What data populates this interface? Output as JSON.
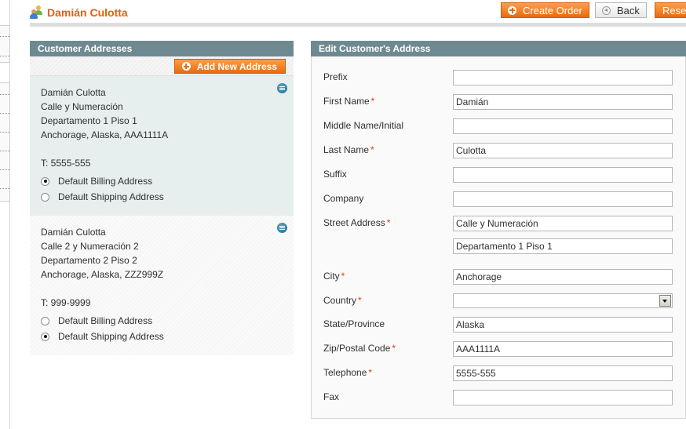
{
  "header": {
    "title": "Damián Culotta",
    "buttons": {
      "create_order": "Create Order",
      "back": "Back",
      "reset": "Rese"
    }
  },
  "addresses_panel": {
    "title": "Customer Addresses",
    "add_button": "Add New Address",
    "addresses": [
      {
        "name": "Damián Culotta",
        "street1": "Calle y Numeración",
        "street2": "Departamento 1 Piso 1",
        "city_line": "Anchorage, Alaska, AAA1111A",
        "phone": "T: 5555-555",
        "default_billing_label": "Default Billing Address",
        "default_billing": true,
        "default_shipping_label": "Default Shipping Address",
        "default_shipping": false,
        "selected": true
      },
      {
        "name": "Damián Culotta",
        "street1": "Calle 2 y Numeración 2",
        "street2": "Departamento 2 Piso 2",
        "city_line": "Anchorage, Alaska, ZZZ999Z",
        "phone": "T: 999-9999",
        "default_billing_label": "Default Billing Address",
        "default_billing": false,
        "default_shipping_label": "Default Shipping Address",
        "default_shipping": true,
        "selected": false
      }
    ]
  },
  "edit_panel": {
    "title": "Edit Customer's Address",
    "fields": {
      "prefix": {
        "label": "Prefix",
        "value": "",
        "required": false
      },
      "first_name": {
        "label": "First Name",
        "value": "Damián",
        "required": true
      },
      "middle_name": {
        "label": "Middle Name/Initial",
        "value": "",
        "required": false
      },
      "last_name": {
        "label": "Last Name",
        "value": "Culotta",
        "required": true
      },
      "suffix": {
        "label": "Suffix",
        "value": "",
        "required": false
      },
      "company": {
        "label": "Company",
        "value": "",
        "required": false
      },
      "street": {
        "label": "Street Address",
        "value": "Calle y Numeración",
        "value2": "Departamento 1 Piso 1",
        "required": true
      },
      "city": {
        "label": "City",
        "value": "Anchorage",
        "required": true
      },
      "country": {
        "label": "Country",
        "value": "",
        "required": true
      },
      "state": {
        "label": "State/Province",
        "value": "Alaska",
        "required": false
      },
      "zip": {
        "label": "Zip/Postal Code",
        "value": "AAA1111A",
        "required": true
      },
      "telephone": {
        "label": "Telephone",
        "value": "5555-555",
        "required": true
      },
      "fax": {
        "label": "Fax",
        "value": "",
        "required": false
      }
    },
    "required_marker": "*"
  },
  "colors": {
    "accent_orange": "#eb5e00",
    "panel_header": "#6f8992",
    "required": "#eb340a"
  }
}
